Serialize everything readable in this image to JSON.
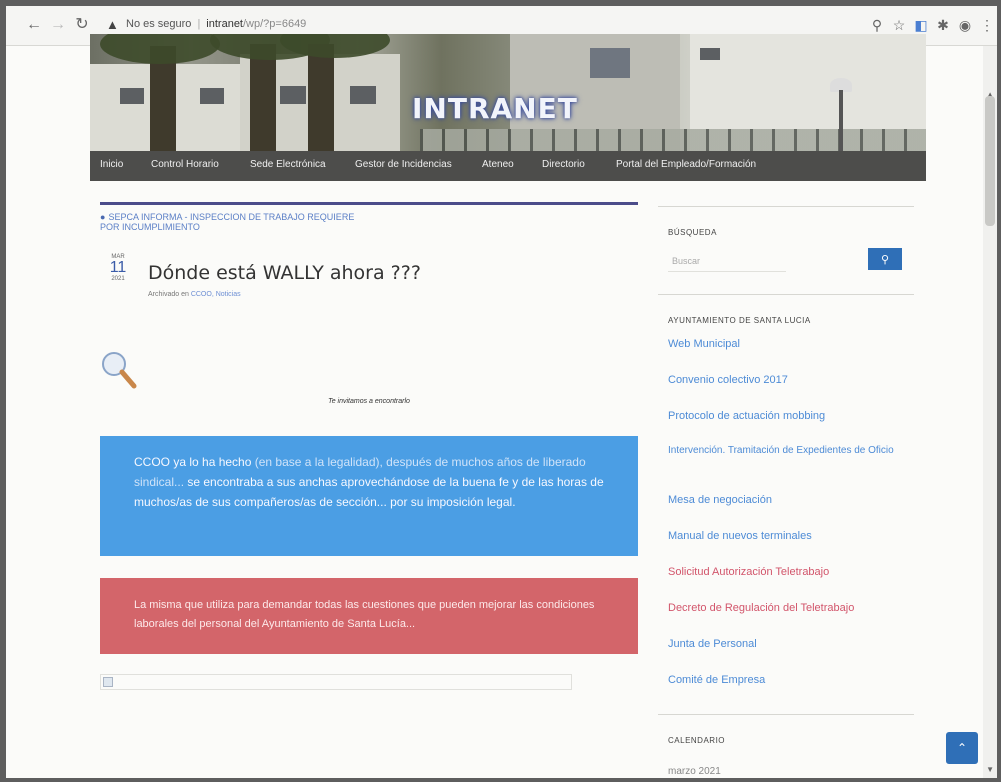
{
  "browser": {
    "security_warning": "No es seguro",
    "url_host": "intranet",
    "url_path": "/wp/?p=6649"
  },
  "header": {
    "site_title": "INTRANET"
  },
  "nav": {
    "items": [
      {
        "label": "Inicio"
      },
      {
        "label": "Control Horario"
      },
      {
        "label": "Sede Electrónica"
      },
      {
        "label": "Gestor de Incidencias"
      },
      {
        "label": "Ateneo"
      },
      {
        "label": "Directorio"
      },
      {
        "label": "Portal del Empleado/Formación"
      }
    ]
  },
  "post": {
    "prev_link": "SEPCA INFORMA - INSPECCION DE TRABAJO REQUIERE POR INCUMPLIMIENTO",
    "date_month": "MAR",
    "date_day": "11",
    "date_year": "2021",
    "title": "Dónde está WALLY ahora ???",
    "meta_prefix": "Archivado en",
    "meta_category": "CCOO, Noticias",
    "invite_text": "Te invitamos a encontrarlo",
    "blue_box": {
      "part1": "CCOO ya lo ha hecho",
      "part2": " (en base a la legalidad), después de muchos años de liberado sindical...",
      "part3": " se encontraba a sus anchas aprovechándose de la buena fe y de las horas de muchos/as de sus compañeros/as de sección... por su imposición legal."
    },
    "red_box": {
      "text": "La misma que utiliza para demandar todas las cuestiones que pueden mejorar las condiciones laborales del personal del Ayuntamiento de Santa Lucía..."
    }
  },
  "sidebar": {
    "search_title": "BÚSQUEDA",
    "search_placeholder": "Buscar",
    "ayto_title": "AYUNTAMIENTO DE SANTA LUCIA",
    "links": [
      {
        "label": "Web Municipal"
      },
      {
        "label": "Convenio colectivo 2017"
      },
      {
        "label": "Protocolo de actuación mobbing"
      },
      {
        "label": "Intervención. Tramitación de Expedientes de Oficio"
      },
      {
        "label": "Mesa de negociación"
      },
      {
        "label": "Manual de nuevos terminales"
      },
      {
        "label": "Solicitud Autorización Teletrabajo"
      },
      {
        "label": "Decreto de Regulación del Teletrabajo"
      },
      {
        "label": "Junta de Personal"
      },
      {
        "label": "Comité de Empresa"
      }
    ],
    "calendar_title": "CALENDARIO",
    "calendar_month": "marzo 2021"
  },
  "colors": {
    "nav_bg": "#4d4d4b",
    "blue_box": "#4b9ee4",
    "red_box": "#d3656a",
    "link_blue": "#4d8bd6",
    "link_red": "#d2556b",
    "accent_button": "#2f6fb7"
  }
}
